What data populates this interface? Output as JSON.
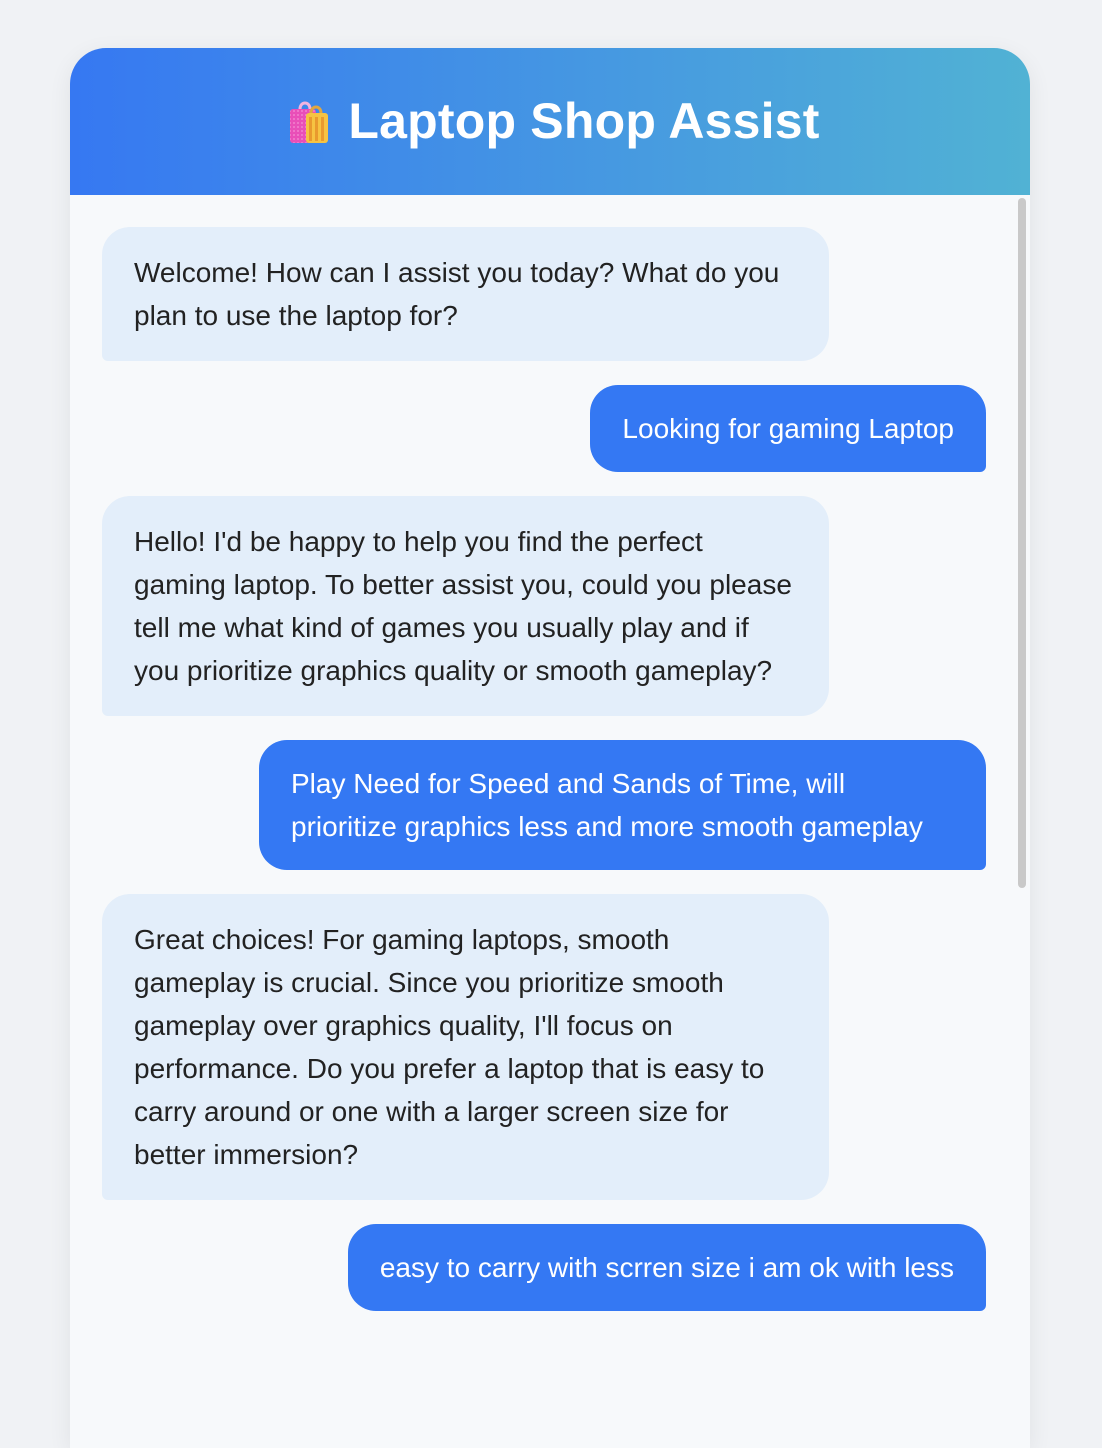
{
  "header": {
    "icon": "shopping-bags-icon",
    "title": "Laptop Shop Assist"
  },
  "colors": {
    "header_gradient_start": "#3678f2",
    "header_gradient_end": "#51b2d4",
    "bot_bubble": "#e3eefa",
    "user_bubble": "#3478f3"
  },
  "messages": [
    {
      "role": "bot",
      "text": "Welcome! How can I assist you today? What do you plan to use the laptop for?"
    },
    {
      "role": "user",
      "text": "Looking for gaming Laptop"
    },
    {
      "role": "bot",
      "text": "Hello! I'd be happy to help you find the perfect gaming laptop. To better assist you, could you please tell me what kind of games you usually play and if you prioritize graphics quality or smooth gameplay?"
    },
    {
      "role": "user",
      "text": "Play Need for Speed and Sands of Time, will prioritize graphics less and more smooth gameplay"
    },
    {
      "role": "bot",
      "text": "Great choices! For gaming laptops, smooth gameplay is crucial. Since you prioritize smooth gameplay over graphics quality, I'll focus on performance. Do you prefer a laptop that is easy to carry around or one with a larger screen size for better immersion?"
    },
    {
      "role": "user",
      "text": "easy to carry with scrren size i am ok with less"
    }
  ]
}
